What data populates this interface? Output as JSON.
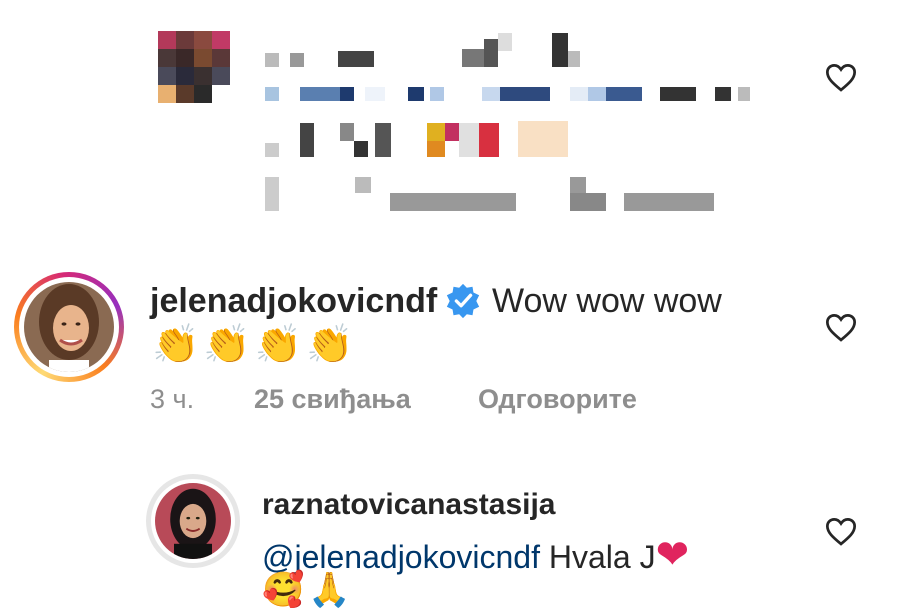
{
  "comments": [
    {
      "username": "jelenadjokovicndf",
      "verified": true,
      "text": "Wow wow wow",
      "emojis": "👏👏👏👏",
      "time": "3 ч.",
      "likes": "25 свиђања",
      "reply_label": "Одговорите"
    },
    {
      "username": "raznatovicanastasija",
      "mention": "@jelenadjokovicndf",
      "text": "Hvala J",
      "emojis": "❤",
      "emojis_line2": "🥰🙏"
    }
  ],
  "icons": {
    "like": "heart-outline-icon",
    "verified": "blue-verified-badge-icon"
  },
  "colors": {
    "text": "#262626",
    "meta": "#8e8e8e",
    "mention": "#00376b",
    "verified": "#3897f0",
    "heart": "#e0245e"
  }
}
